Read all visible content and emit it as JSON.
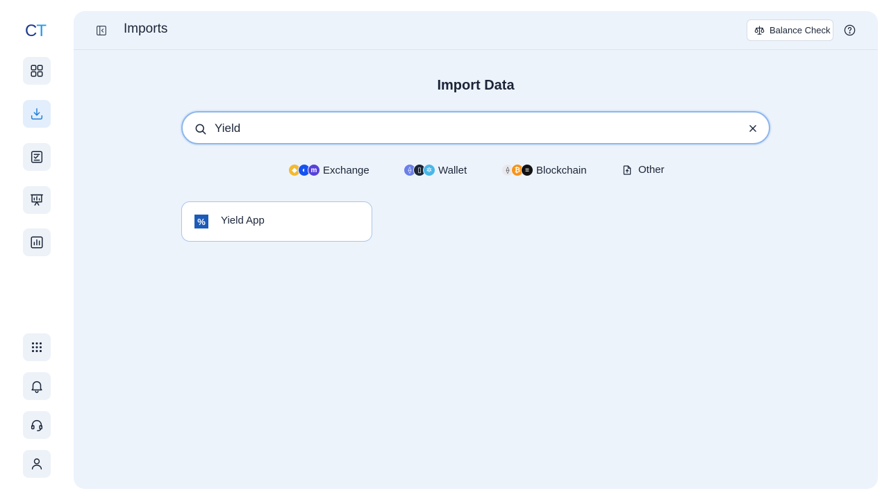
{
  "app": {
    "logo_c": "C",
    "logo_t": "T",
    "colors": {
      "accent": "#1e9bf0",
      "brand_dark": "#1c3a8a",
      "panel_bg": "#edf3fb",
      "search_border": "#8fb6ea"
    }
  },
  "rail": {
    "top_items": [
      {
        "name": "dashboard-icon"
      },
      {
        "name": "import-icon",
        "active": true
      },
      {
        "name": "transactions-icon"
      },
      {
        "name": "presentation-icon"
      },
      {
        "name": "reports-icon"
      }
    ],
    "bottom_items": [
      {
        "name": "apps-grid-icon"
      },
      {
        "name": "notification-bell-icon"
      },
      {
        "name": "support-headset-icon"
      },
      {
        "name": "user-profile-icon"
      }
    ]
  },
  "header": {
    "title": "Imports",
    "balance_check_label": "Balance Check",
    "help_icon": "question-circle-icon"
  },
  "main": {
    "heading": "Import Data",
    "search": {
      "value": "Yield",
      "placeholder": ""
    },
    "filters": [
      {
        "label": "Exchange"
      },
      {
        "label": "Wallet"
      },
      {
        "label": "Blockchain"
      },
      {
        "label": "Other"
      }
    ],
    "results": [
      {
        "name": "Yield App"
      }
    ]
  }
}
